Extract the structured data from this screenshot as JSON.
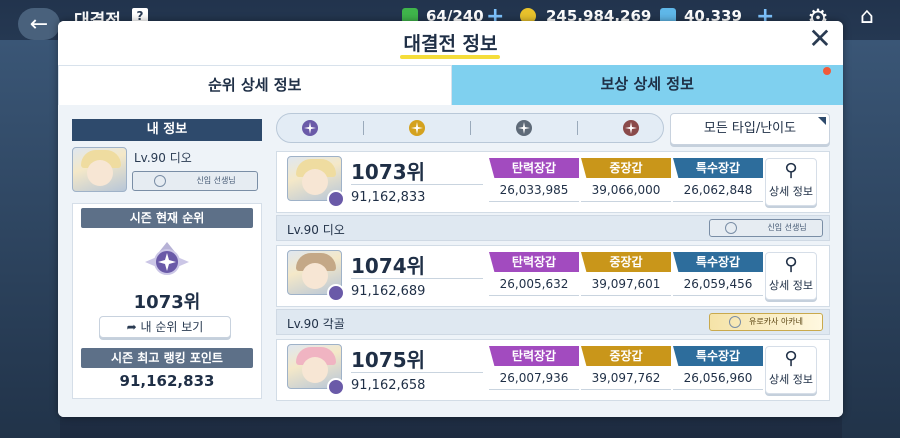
{
  "topbar": {
    "title": "대결전",
    "help": "?",
    "stamina": "64/240",
    "credits": "245,984,269",
    "gems": "40,339"
  },
  "modal": {
    "title": "대결전 정보",
    "tabs": [
      {
        "label": "순위 상세 정보"
      },
      {
        "label": "보상 상세 정보"
      }
    ]
  },
  "my_info": {
    "header": "내 정보",
    "level_name": "Lv.90 디오",
    "badge": "신입 선생님",
    "season_header": "시즌 현재 순위",
    "season_rank": "1073위",
    "my_rank_button": "내 순위 보기",
    "best_header": "시즌 최고 랭킹 포인트",
    "best_points": "91,162,833"
  },
  "filter": {
    "dropdown": "모든 타입/난이도"
  },
  "stat_labels": {
    "a": "탄력장갑",
    "b": "중장갑",
    "c": "특수장갑"
  },
  "detail_label": "상세 정보",
  "entries": [
    {
      "rank": "1073위",
      "points": "91,162,833",
      "a": "26,033,985",
      "b": "39,066,000",
      "c": "26,062,848",
      "player": "Lv.90 디오",
      "badge": "신입 선생님"
    },
    {
      "rank": "1074위",
      "points": "91,162,689",
      "a": "26,005,632",
      "b": "39,097,601",
      "c": "26,059,456",
      "player": "Lv.90 각골",
      "badge": "유로카사 아카네"
    },
    {
      "rank": "1075위",
      "points": "91,162,658",
      "a": "26,007,936",
      "b": "39,097,762",
      "c": "26,056,960",
      "player": "",
      "badge": ""
    }
  ],
  "colors": {
    "armor_a": "#a24bbf",
    "armor_b": "#c9961a",
    "armor_c": "#2d6d9c"
  }
}
